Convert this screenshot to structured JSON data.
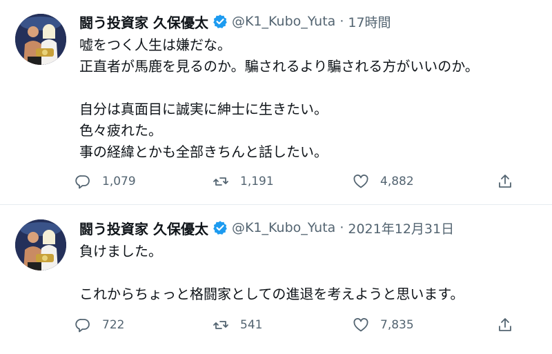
{
  "tweets": [
    {
      "author": {
        "display_name": "闘う投資家 久保優太",
        "handle": "@K1_Kubo_Yuta",
        "verified": true
      },
      "separator": "·",
      "time": "17時間",
      "lines": [
        "嘘をつく人生は嫌だな。",
        "正直者が馬鹿を見るのか。騙されるより騙される方がいいのか。",
        "",
        "自分は真面目に誠実に紳士に生きたい。",
        "色々疲れた。",
        "事の経緯とかも全部きちんと話したい。"
      ],
      "stats": {
        "replies": "1,079",
        "retweets": "1,191",
        "likes": "4,882"
      }
    },
    {
      "author": {
        "display_name": "闘う投資家 久保優太",
        "handle": "@K1_Kubo_Yuta",
        "verified": true
      },
      "separator": "·",
      "time": "2021年12月31日",
      "lines": [
        "負けました。",
        "",
        "これからちょっと格闘家としての進退を考えようと思います。"
      ],
      "stats": {
        "replies": "722",
        "retweets": "541",
        "likes": "7,835"
      }
    }
  ],
  "icons": {
    "verified": "verified-badge-icon",
    "reply": "reply-icon",
    "retweet": "retweet-icon",
    "like": "heart-icon",
    "share": "share-icon"
  },
  "colors": {
    "text": "#0f1419",
    "secondary_text": "#536471",
    "verified_badge": "#1d9bf0",
    "separator": "#e6ecf0"
  }
}
